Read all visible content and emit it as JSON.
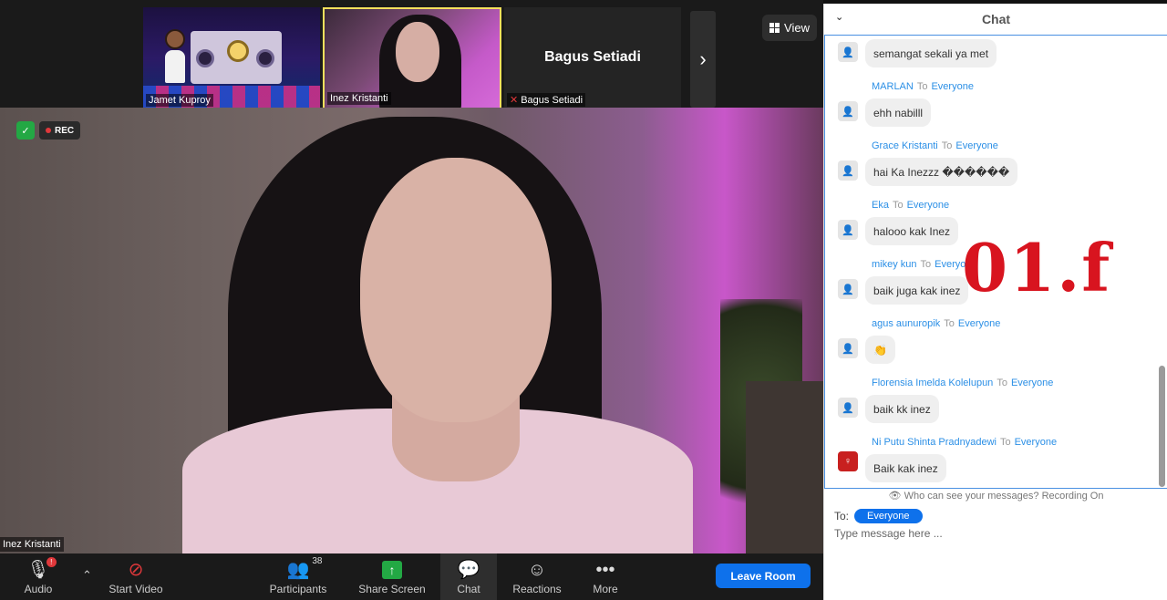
{
  "meeting": {
    "tiles": [
      {
        "name": "Jamet Kuproy"
      },
      {
        "name": "Inez Kristanti"
      },
      {
        "name": "Bagus Setiadi",
        "display": "Bagus Setiadi"
      }
    ],
    "view_label": "View",
    "main_speaker": "Inez Kristanti",
    "rec_label": "REC",
    "watermark": "01.f"
  },
  "toolbar": {
    "audio": "Audio",
    "audio_badge": "!",
    "start_video": "Start Video",
    "participants": "Participants",
    "participants_count": "38",
    "share_screen": "Share Screen",
    "chat": "Chat",
    "reactions": "Reactions",
    "more": "More",
    "leave": "Leave Room"
  },
  "chat": {
    "title": "Chat",
    "to_word": "To",
    "messages": [
      {
        "sender": "",
        "recipient": "",
        "text": "semangat sekali ya met"
      },
      {
        "sender": "MARLAN",
        "recipient": "Everyone",
        "text": "ehh nabilll"
      },
      {
        "sender": "Grace Kristanti",
        "recipient": "Everyone",
        "text": "hai Ka Inezzz ������"
      },
      {
        "sender": "Eka",
        "recipient": "Everyone",
        "text": "halooo kak Inez"
      },
      {
        "sender": "mikey kun",
        "recipient": "Everyone",
        "text": "baik juga kak inez"
      },
      {
        "sender": "agus aunuropik",
        "recipient": "Everyone",
        "text": "👏"
      },
      {
        "sender": "Florensia Imelda Kolelupun",
        "recipient": "Everyone",
        "text": "baik kk inez"
      },
      {
        "sender": "Ni Putu Shinta Pradnyadewi",
        "recipient": "Everyone",
        "text": "Baik kak inez"
      }
    ],
    "visibility_note": "Who can see your messages? Recording On",
    "to_label": "To:",
    "recipient": "Everyone",
    "input_placeholder": "Type message here ..."
  }
}
